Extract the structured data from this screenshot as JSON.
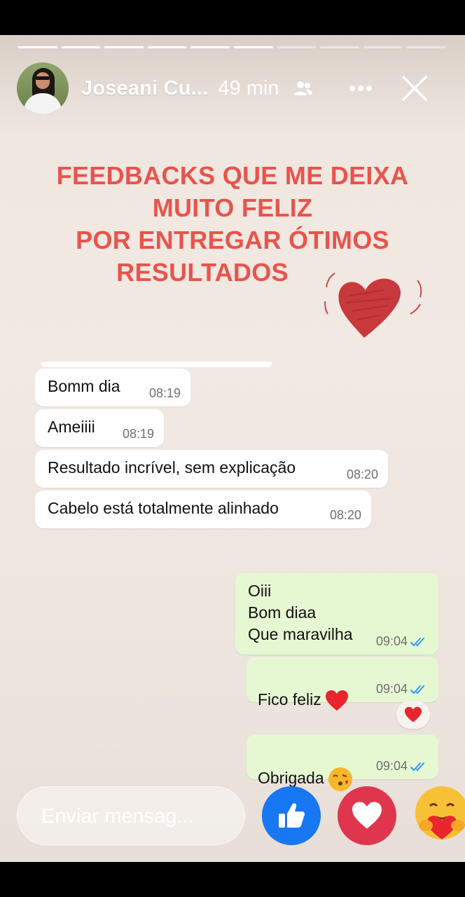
{
  "story": {
    "progress": {
      "total_segments": 10,
      "completed_segments": 6
    },
    "user_name": "Joseani Cu...",
    "time_ago": "49 min",
    "title_lines": [
      "FEEDBACKS QUE ME DEIXA",
      "MUITO FELIZ",
      "POR ENTREGAR ÓTIMOS",
      "RESULTADOS"
    ],
    "title_color": "#e8544c"
  },
  "chat": {
    "messages": [
      {
        "dir": "in",
        "text": "Bomm dia",
        "time": "08:19"
      },
      {
        "dir": "in",
        "text": "Ameiiii",
        "time": "08:19"
      },
      {
        "dir": "in",
        "text": "Resultado incrível, sem explicação",
        "time": "08:20"
      },
      {
        "dir": "in",
        "text": "Cabelo está totalmente alinhado",
        "time": "08:20"
      },
      {
        "dir": "out",
        "text": "Oiii\nBom diaa\nQue maravilha",
        "time": "09:04",
        "read": true
      },
      {
        "dir": "out",
        "text": "Fico feliz",
        "emoji": "red-heart",
        "time": "09:04",
        "read": true,
        "reaction": "red-heart"
      },
      {
        "dir": "out",
        "text": "Obrigada",
        "emoji": "face-blowing-kiss",
        "time": "09:04",
        "read": true
      }
    ],
    "colors": {
      "incoming": "#ffffff",
      "outgoing": "#e5f8d2",
      "read_ticks": "#3497f9"
    }
  },
  "bottom_bar": {
    "reply_placeholder": "Enviar mensag...",
    "reactions": [
      "like",
      "love",
      "care"
    ]
  }
}
